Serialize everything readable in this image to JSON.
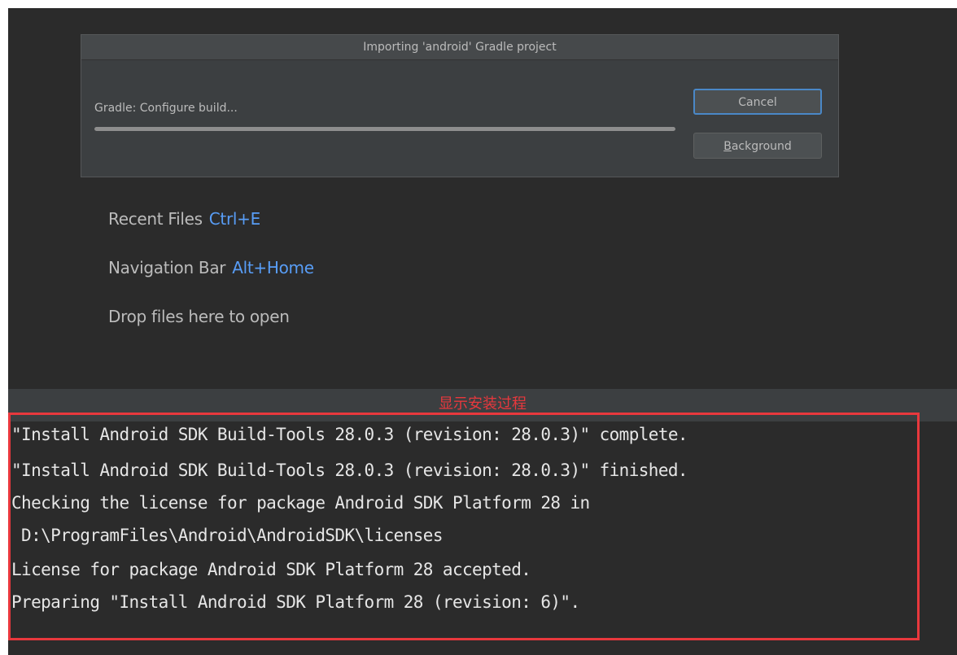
{
  "dialog": {
    "title": "Importing 'android' Gradle project",
    "progress_label": "Gradle: Configure build...",
    "progress_fraction": 1.0,
    "cancel_label": "Cancel",
    "background_mnemonic": "B",
    "background_rest": "ackground"
  },
  "hints": {
    "recent_files": {
      "label": "Recent Files",
      "shortcut": "Ctrl+E"
    },
    "navigation_bar": {
      "label": "Navigation Bar",
      "shortcut": "Alt+Home"
    },
    "drop_files": {
      "label": "Drop files here to open"
    }
  },
  "annotation": {
    "label": "显示安装过程",
    "color": "#e8383d"
  },
  "console": {
    "lines": [
      "\"Install Android SDK Build-Tools 28.0.3 (revision: 28.0.3)\" complete.",
      "\"Install Android SDK Build-Tools 28.0.3 (revision: 28.0.3)\" finished.",
      "Checking the license for package Android SDK Platform 28 in",
      " D:\\ProgramFiles\\Android\\AndroidSDK\\licenses",
      "License for package Android SDK Platform 28 accepted.",
      "Preparing \"Install Android SDK Platform 28 (revision: 6)\"."
    ]
  },
  "colors": {
    "background": "#2b2b2b",
    "dialog": "#3c3f41",
    "shortcut": "#589df6",
    "focus_border": "#4a88c7"
  }
}
